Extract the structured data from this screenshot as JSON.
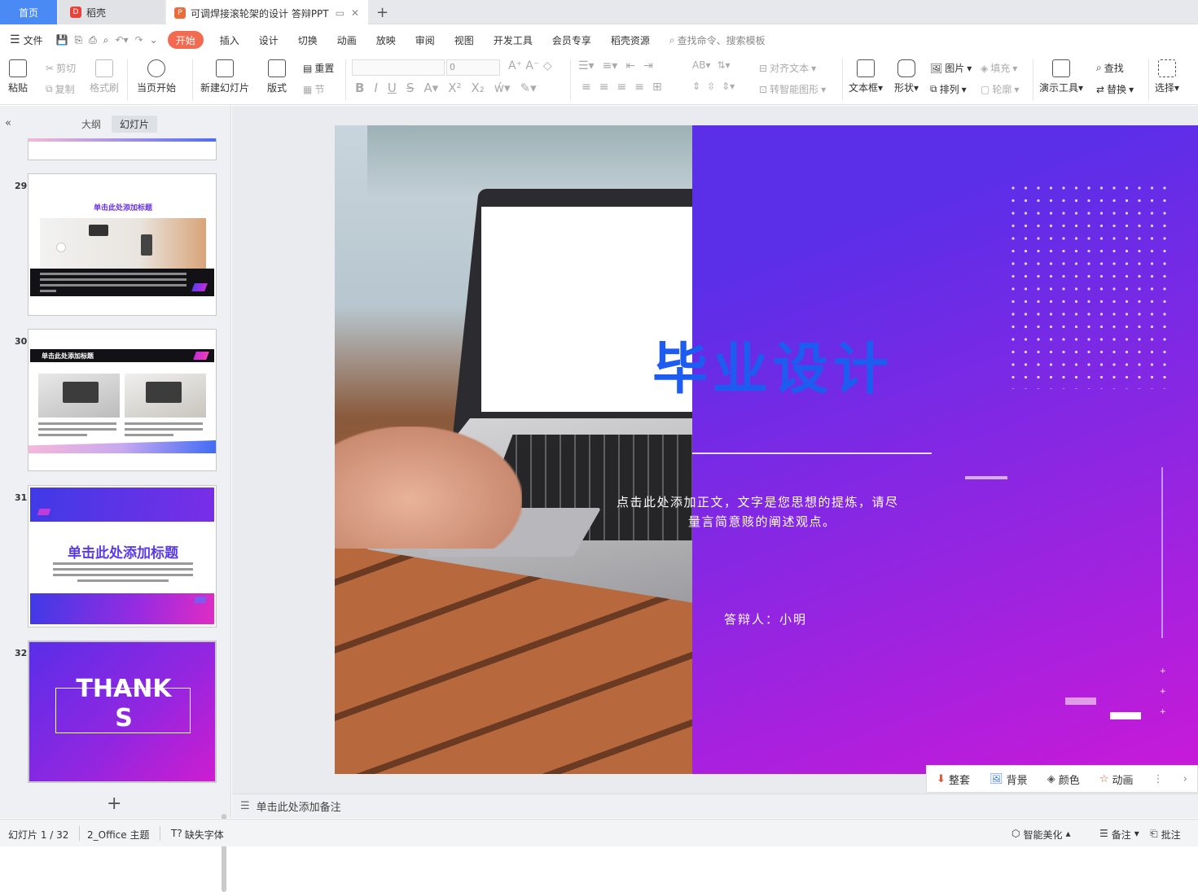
{
  "tabs": {
    "home": "首页",
    "daoke": "稻壳",
    "doc": "可调焊接滚轮架的设计 答辩PPT",
    "new_tab": "+"
  },
  "menu": {
    "file": "文件",
    "items": [
      "开始",
      "插入",
      "设计",
      "切换",
      "动画",
      "放映",
      "审阅",
      "视图",
      "开发工具",
      "会员专享",
      "稻壳资源"
    ],
    "search": "查找命令、搜索模板"
  },
  "ribbon": {
    "paste": "粘贴",
    "cut": "剪切",
    "copy": "复制",
    "format_painter": "格式刷",
    "from_current": "当页开始",
    "new_slide": "新建幻灯片",
    "layout": "版式",
    "section": "节",
    "reset": "重置",
    "font_size": "0",
    "align_text": "对齐文本",
    "smartart": "转智能图形",
    "textbox": "文本框",
    "shape": "形状",
    "picture": "图片",
    "arrange": "排列",
    "fill": "填充",
    "outline": "轮廓",
    "presenter_tools": "演示工具",
    "find": "查找",
    "replace": "替换",
    "select": "选择"
  },
  "leftpanel": {
    "tab_outline": "大纲",
    "tab_slides": "幻灯片",
    "slides": [
      {
        "num": "29",
        "title": "单击此处添加标题"
      },
      {
        "num": "30",
        "title": "单击此处添加标题"
      },
      {
        "num": "31",
        "title": "单击此处添加标题"
      },
      {
        "num": "32",
        "title": "THANK S"
      }
    ]
  },
  "slide": {
    "title": "毕业设计",
    "body_line1": "点击此处添加正文，文字是您思想的提炼，请尽",
    "body_line2": "量言简意赅的阐述观点。",
    "presenter": "答辩人：小明"
  },
  "floatbar": {
    "template": "整套",
    "background": "背景",
    "color": "颜色",
    "animation": "动画"
  },
  "notes": "单击此处添加备注",
  "status": {
    "slide_count": "幻灯片 1 / 32",
    "theme": "2_Office 主题",
    "missing_font": "缺失字体",
    "beautify": "智能美化",
    "notes": "备注",
    "comments": "批注"
  },
  "colors": {
    "accent": "#f26a4f",
    "home_tab": "#4a8af4",
    "slide_gradient_start": "#5b2ee8",
    "slide_gradient_end": "#c81ad8",
    "title_blue": "#1d5cf0"
  }
}
